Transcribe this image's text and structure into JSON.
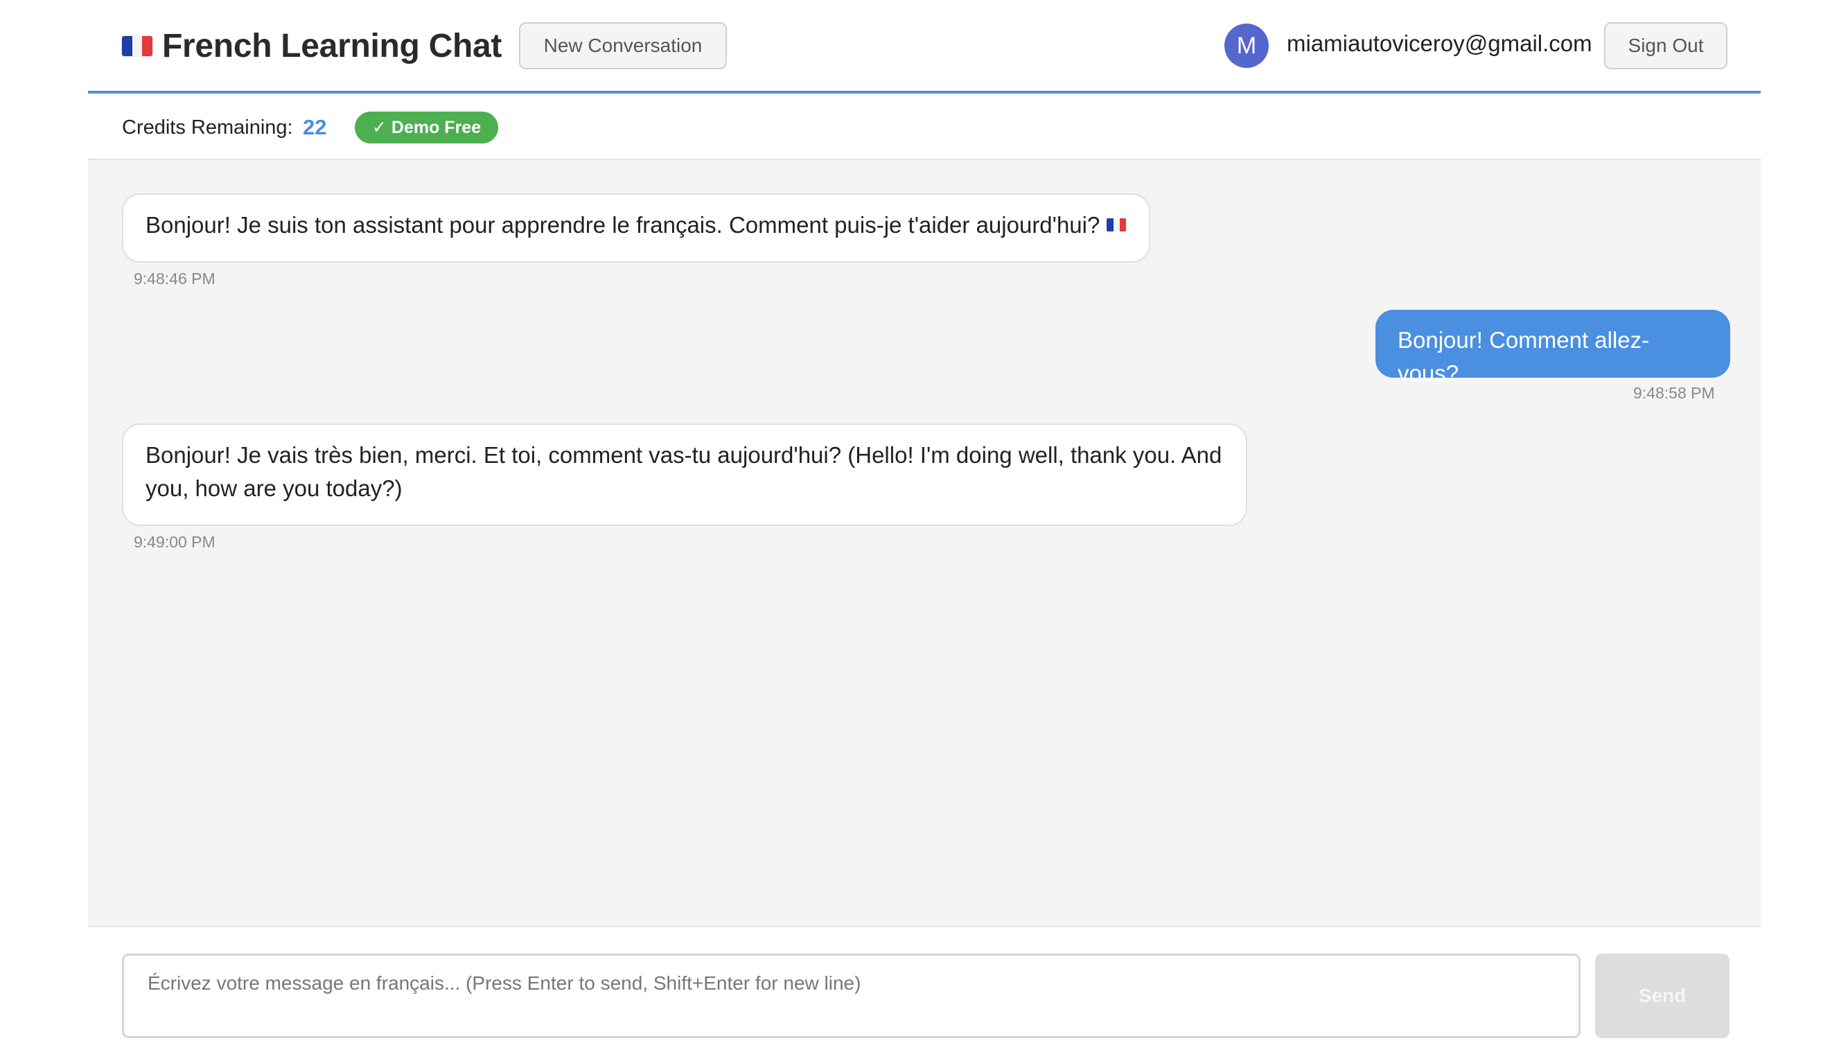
{
  "header": {
    "title": "French Learning Chat",
    "flag_icon": "french-flag-icon",
    "new_conversation_label": "New Conversation",
    "user": {
      "avatar_initial": "M",
      "email": "miamiautoviceroy@gmail.com"
    },
    "sign_out_label": "Sign Out"
  },
  "credits": {
    "label": "Credits Remaining:",
    "value": "22",
    "badge": "✓ Demo Free"
  },
  "messages": [
    {
      "role": "assistant",
      "text": "Bonjour! Je suis ton assistant pour apprendre le français. Comment puis-je t'aider aujourd'hui?",
      "trailing_icon": "french-flag-icon",
      "time": "9:48:46 PM"
    },
    {
      "role": "user",
      "text": "Bonjour! Comment allez-vous?",
      "time": "9:48:58 PM"
    },
    {
      "role": "assistant",
      "text": "Bonjour! Je vais très bien, merci. Et toi, comment vas-tu aujourd'hui? (Hello! I'm doing well, thank you. And you, how are you today?)",
      "time": "9:49:00 PM"
    }
  ],
  "composer": {
    "placeholder": "Écrivez votre message en français... (Press Enter to send, Shift+Enter for new line)",
    "value": "",
    "send_label": "Send"
  },
  "colors": {
    "accent": "#4a8fe0",
    "badge_green": "#4caf50",
    "avatar": "#5566cc",
    "chat_background": "#f4f4f4"
  }
}
